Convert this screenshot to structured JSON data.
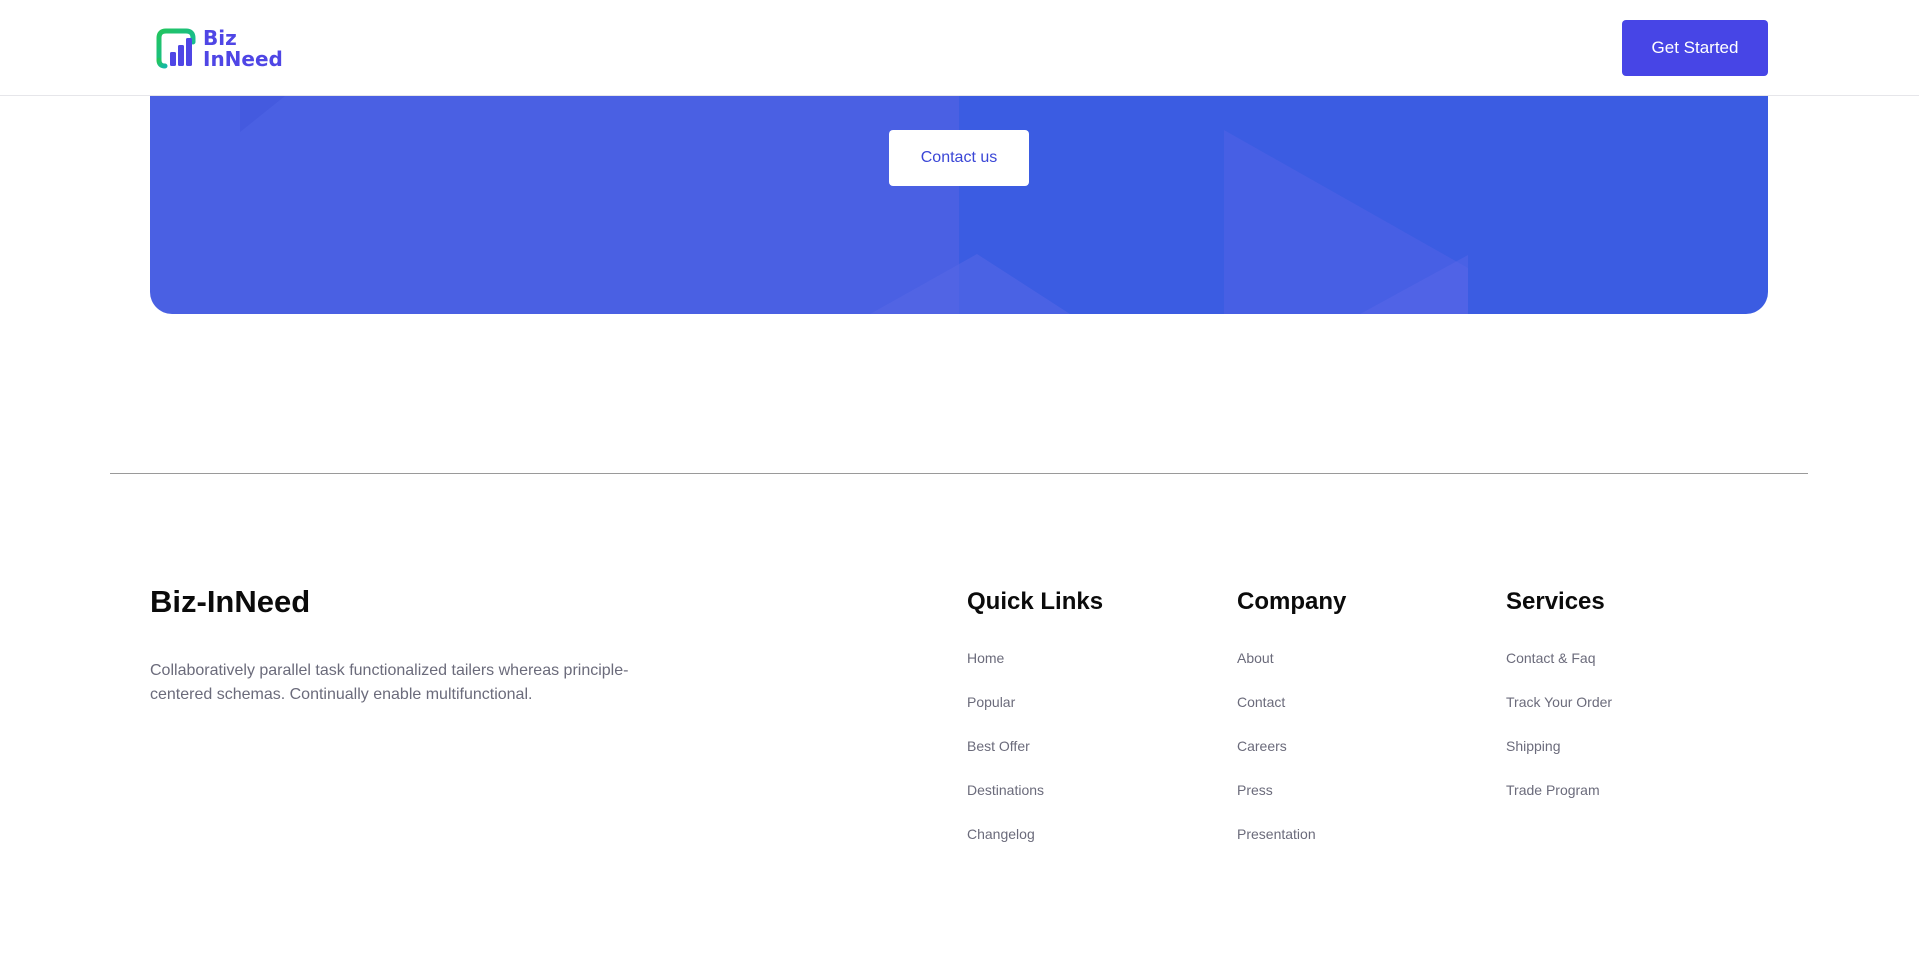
{
  "header": {
    "logo_line1": "Biz",
    "logo_line2": "InNeed",
    "cta_label": "Get Started"
  },
  "banner": {
    "contact_label": "Contact us"
  },
  "footer": {
    "brand_title": "Biz-InNeed",
    "brand_description": "Collaboratively parallel task functionalized tailers whereas principle-centered schemas. Continually enable multifunctional.",
    "columns": [
      {
        "title": "Quick Links",
        "links": [
          "Home",
          "Popular",
          "Best Offer",
          "Destinations",
          "Changelog"
        ]
      },
      {
        "title": "Company",
        "links": [
          "About",
          "Contact",
          "Careers",
          "Press",
          "Presentation"
        ]
      },
      {
        "title": "Services",
        "links": [
          "Contact & Faq",
          "Track Your Order",
          "Shipping",
          "Trade Program"
        ]
      }
    ]
  },
  "colors": {
    "primary": "#4745e6",
    "banner_left": "#4a60e3",
    "banner_right": "#3b5ce2",
    "logo_green": "#22c55e",
    "logo_blue": "#4f46e5",
    "muted_text": "#6b6b7b"
  }
}
